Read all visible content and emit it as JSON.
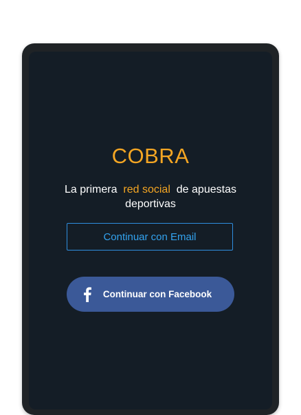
{
  "app": {
    "brand": "COBRA",
    "tagline": {
      "prefix": "La primera",
      "highlight": "red social",
      "suffix": "de apuestas deportivas"
    }
  },
  "actions": {
    "email_label": "Continuar con Email",
    "facebook_label": "Continuar con Facebook"
  },
  "colors": {
    "accent": "#f5a623",
    "background": "#141d26",
    "email_border": "#2f8fe0",
    "facebook": "#3b5998"
  },
  "icons": {
    "facebook": "facebook-icon"
  }
}
